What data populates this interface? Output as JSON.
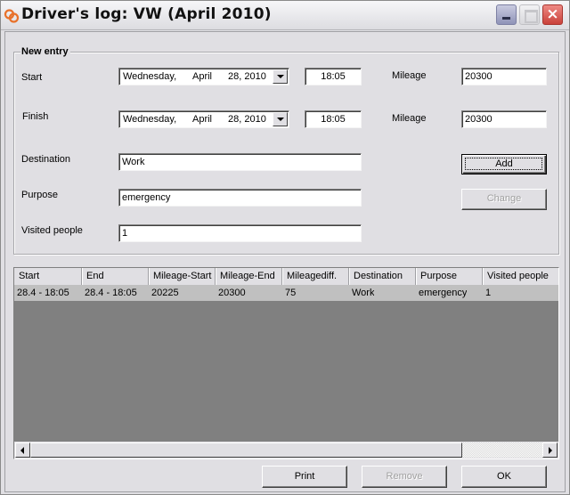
{
  "window": {
    "title": "Driver's log: VW (April 2010)",
    "controls": {
      "minimize": "minimize",
      "maximize": "maximize",
      "close": "×"
    }
  },
  "new_entry": {
    "group_title": "New entry",
    "start": {
      "label": "Start",
      "date": {
        "weekday": "Wednesday,",
        "month": "April",
        "day_year": "28, 2010"
      },
      "time": "18:05",
      "mileage_label": "Mileage",
      "mileage": "20300"
    },
    "finish": {
      "label": "Finish",
      "date": {
        "weekday": "Wednesday,",
        "month": "April",
        "day_year": "28, 2010"
      },
      "time": "18:05",
      "mileage_label": "Mileage",
      "mileage": "20300"
    },
    "destination": {
      "label": "Destination",
      "value": "Work"
    },
    "purpose": {
      "label": "Purpose",
      "value": "emergency"
    },
    "visited_people": {
      "label": "Visited people",
      "value": "1"
    },
    "buttons": {
      "add": "Add",
      "change": "Change"
    }
  },
  "log_table": {
    "columns": [
      "Start",
      "End",
      "Mileage-Start",
      "Mileage-End",
      "Mileagediff.",
      "Destination",
      "Purpose",
      "Visited people"
    ],
    "rows": [
      [
        "28.4 - 18:05",
        "28.4 - 18:05",
        "20225",
        "20300",
        "75",
        "Work",
        "emergency",
        "1"
      ]
    ]
  },
  "footer": {
    "print": "Print",
    "remove": "Remove",
    "ok": "OK"
  },
  "colors": {
    "face": "#e0dfe3",
    "list_empty": "#808080",
    "row_selected": "#c0c0c0",
    "app_icon": "#e8712a"
  }
}
